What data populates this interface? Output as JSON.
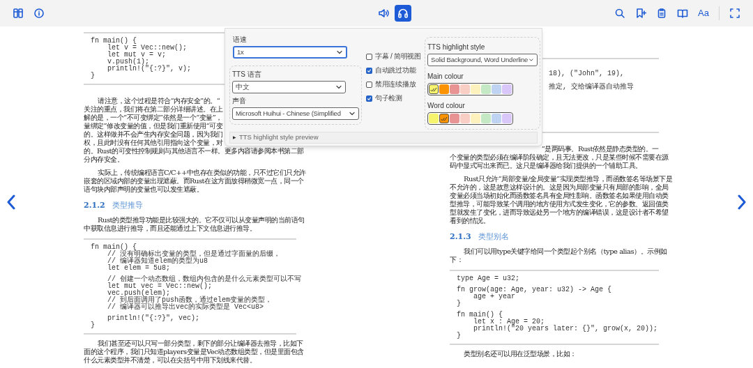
{
  "toolbar": {
    "left": [
      {
        "kind": "library"
      },
      {
        "kind": "info"
      }
    ],
    "center": [
      {
        "kind": "volume",
        "selected": false
      },
      {
        "kind": "tts",
        "selected": true
      }
    ],
    "right": [
      {
        "kind": "search"
      },
      {
        "kind": "bookmark_add"
      },
      {
        "kind": "notes"
      },
      {
        "kind": "contents"
      },
      {
        "kind": "font",
        "label": "Aa"
      },
      {
        "kind": "fullscreen"
      }
    ]
  },
  "tts_panel": {
    "speed": {
      "label": "语速",
      "value": "1x",
      "focused": true
    },
    "language": {
      "label": "TTS 语言",
      "value": "中文"
    },
    "voice": {
      "label": "声音",
      "value": "Microsoft Huihui - Chinese (Simplified"
    },
    "options": [
      {
        "label": "字幕 / 简明视图",
        "checked": false
      },
      {
        "label": "自动跳过功能",
        "checked": true
      },
      {
        "label": "禁用连续播放",
        "checked": false
      },
      {
        "label": "句子检测",
        "checked": true
      }
    ],
    "highlight_style": {
      "label": "TTS highlight style",
      "value": "Solid Background, Word Underline"
    },
    "main_colour": {
      "label": "Main colour",
      "swatches": [
        {
          "color": "#f6f36d",
          "selected": true
        },
        {
          "color": "#fb9200",
          "selected": false
        },
        {
          "color": "#e99494",
          "selected": false
        },
        {
          "color": "#f9cec4",
          "selected": false
        },
        {
          "color": "#fdf2be",
          "selected": false
        },
        {
          "color": "#c4e9c4",
          "selected": false
        },
        {
          "color": "#bfd3f3",
          "selected": false
        },
        {
          "color": "#d9c7f9",
          "selected": false
        }
      ]
    },
    "word_colour": {
      "label": "Word colour",
      "swatches": [
        {
          "color": "#f6f36d",
          "selected": false
        },
        {
          "color": "#fb9200",
          "selected": true
        },
        {
          "color": "#e99494",
          "selected": false
        },
        {
          "color": "#f9cec4",
          "selected": false
        },
        {
          "color": "#fdf2be",
          "selected": false
        },
        {
          "color": "#c4e9c4",
          "selected": false
        },
        {
          "color": "#bfd3f3",
          "selected": false
        },
        {
          "color": "#d9c7f9",
          "selected": false
        }
      ]
    },
    "preview": {
      "marker": "▶",
      "label": "TTS highlight style preview"
    }
  },
  "left_page": {
    "blocks": [
      {
        "kind": "code",
        "continued": false,
        "groups": [
          [
            "fn main() {",
            "    let v = Vec::new();",
            "    let mut v = v;",
            "    v.push(1);",
            "    println!(\"{:?}\", v);",
            "}"
          ]
        ]
      },
      {
        "kind": "paragraph",
        "continued": false,
        "lines": [
          "请注意，这个过程是符合“内存安全”的。“",
          "关注的重点，我们将在第二部分详细讲述。在上",
          "解的是，一个“不可变绑定”依然是一个“变量”，",
          "量绑定”修改变量的值，但是我们重新使用“可变",
          "的。这样做并不会产生内存安全问题，因为我们",
          "权，且此时没有任何其他引用指向这个变量，对",
          "的。Rust的可变性控制规则与其他语言不一样。更多内容请参阅本书第二部",
          "分内存安全。"
        ]
      },
      {
        "kind": "paragraph",
        "continued": false,
        "lines": [
          "实际上，传统编程语言C/C++中也存在类似的功能，只不过它们只允许",
          "嵌套的区域内部的变量出现遮蔽。而Rust在这方面放得稍微宽一点，同一个",
          "语句块内部声明的变量也可以发生遮蔽。"
        ]
      },
      {
        "kind": "heading",
        "number": "2.1.2",
        "title": "类型推导"
      },
      {
        "kind": "paragraph",
        "continued": false,
        "lines": [
          "Rust的类型推导功能是比较强大的。它不仅可以从变量声明的当前语句",
          "中获取信息进行推导，而且还能通过上下文信息进行推导。"
        ]
      },
      {
        "kind": "code",
        "continued": false,
        "groups": [
          [
            "fn main() {",
            "    // 没有明确标出变量的类型，但是通过字面量的后缀，",
            "    // 编译器知道elem的类型为u8",
            "    let elem = 5u8;"
          ],
          [
            "    // 创建一个动态数组，数组内包含的是什么元素类型可以不写",
            "    let mut vec = Vec::new();",
            "    vec.push(elem);",
            "    // 到后面调用了push函数，通过elem变量的类型，",
            "    // 编译器可以推导出vec的实际类型是 Vec<u8>"
          ],
          [
            "    println!(\"{:?}\", vec);",
            "}"
          ]
        ]
      },
      {
        "kind": "paragraph",
        "continued": false,
        "lines": [
          "我们甚至还可以只写一部分类型，剩下的部分让编译器去推导，比如下",
          "面的这个程序，我们只知道players变量是Vec动态数组类型，但是里面包含",
          "什么元素类型并不清楚，可以在尖括号中用下划线来代替。"
        ]
      }
    ]
  },
  "right_page": {
    "blocks": [
      {
        "kind": "code",
        "continued": true,
        "groups": [
          [
            "18), (\"John\", 19),"
          ],
          [
            "推定, 交给编译器自动推导"
          ]
        ]
      },
      {
        "kind": "paragraph",
        "continued": true,
        "lines": [
          "”是两码事。Rust依然是静态类型的。一",
          "个变量的类型必须在编译阶段确定，且无法更改，只是某些时候不需要在源",
          "码中显式写出来而已。这只是编译器给我们提供的一个辅助工具。"
        ]
      },
      {
        "kind": "paragraph",
        "continued": false,
        "lines": [
          "Rust只允许“局部变量/全局变量”实现类型推导，而函数签名等场景下是",
          "不允许的，这是故意这样设计的。这是因为局部变量只有局部的影响，全局",
          "变量必须当场初始化而函数签名具有全局性影响。函数签名如果使用自动类",
          "型推导，可能导致某个调用的地方使用方式发生变化，它的参数、返回值类",
          "型就发生了变化，进而导致远处另一个地方的编译错误，这是设计者不希望",
          "看到的情况。"
        ]
      },
      {
        "kind": "heading",
        "number": "2.1.3",
        "title": "类型别名"
      },
      {
        "kind": "paragraph",
        "continued": false,
        "lines": [
          "我们可以用type关键字给同一个类型起个别名（type alias）。示例如",
          "下："
        ]
      },
      {
        "kind": "code",
        "continued": false,
        "groups": [
          [
            "type Age = u32;"
          ],
          [
            "fn grow(age: Age, year: u32) -> Age {",
            "    age + year",
            "}"
          ],
          [
            "fn main() {",
            "    let x : Age = 20;",
            "    println!(\"20 years later: {}\", grow(x, 20));",
            "}"
          ]
        ]
      },
      {
        "kind": "paragraph",
        "continued": false,
        "lines": [
          "类型别名还可以用在泛型场景，比如："
        ]
      }
    ]
  }
}
